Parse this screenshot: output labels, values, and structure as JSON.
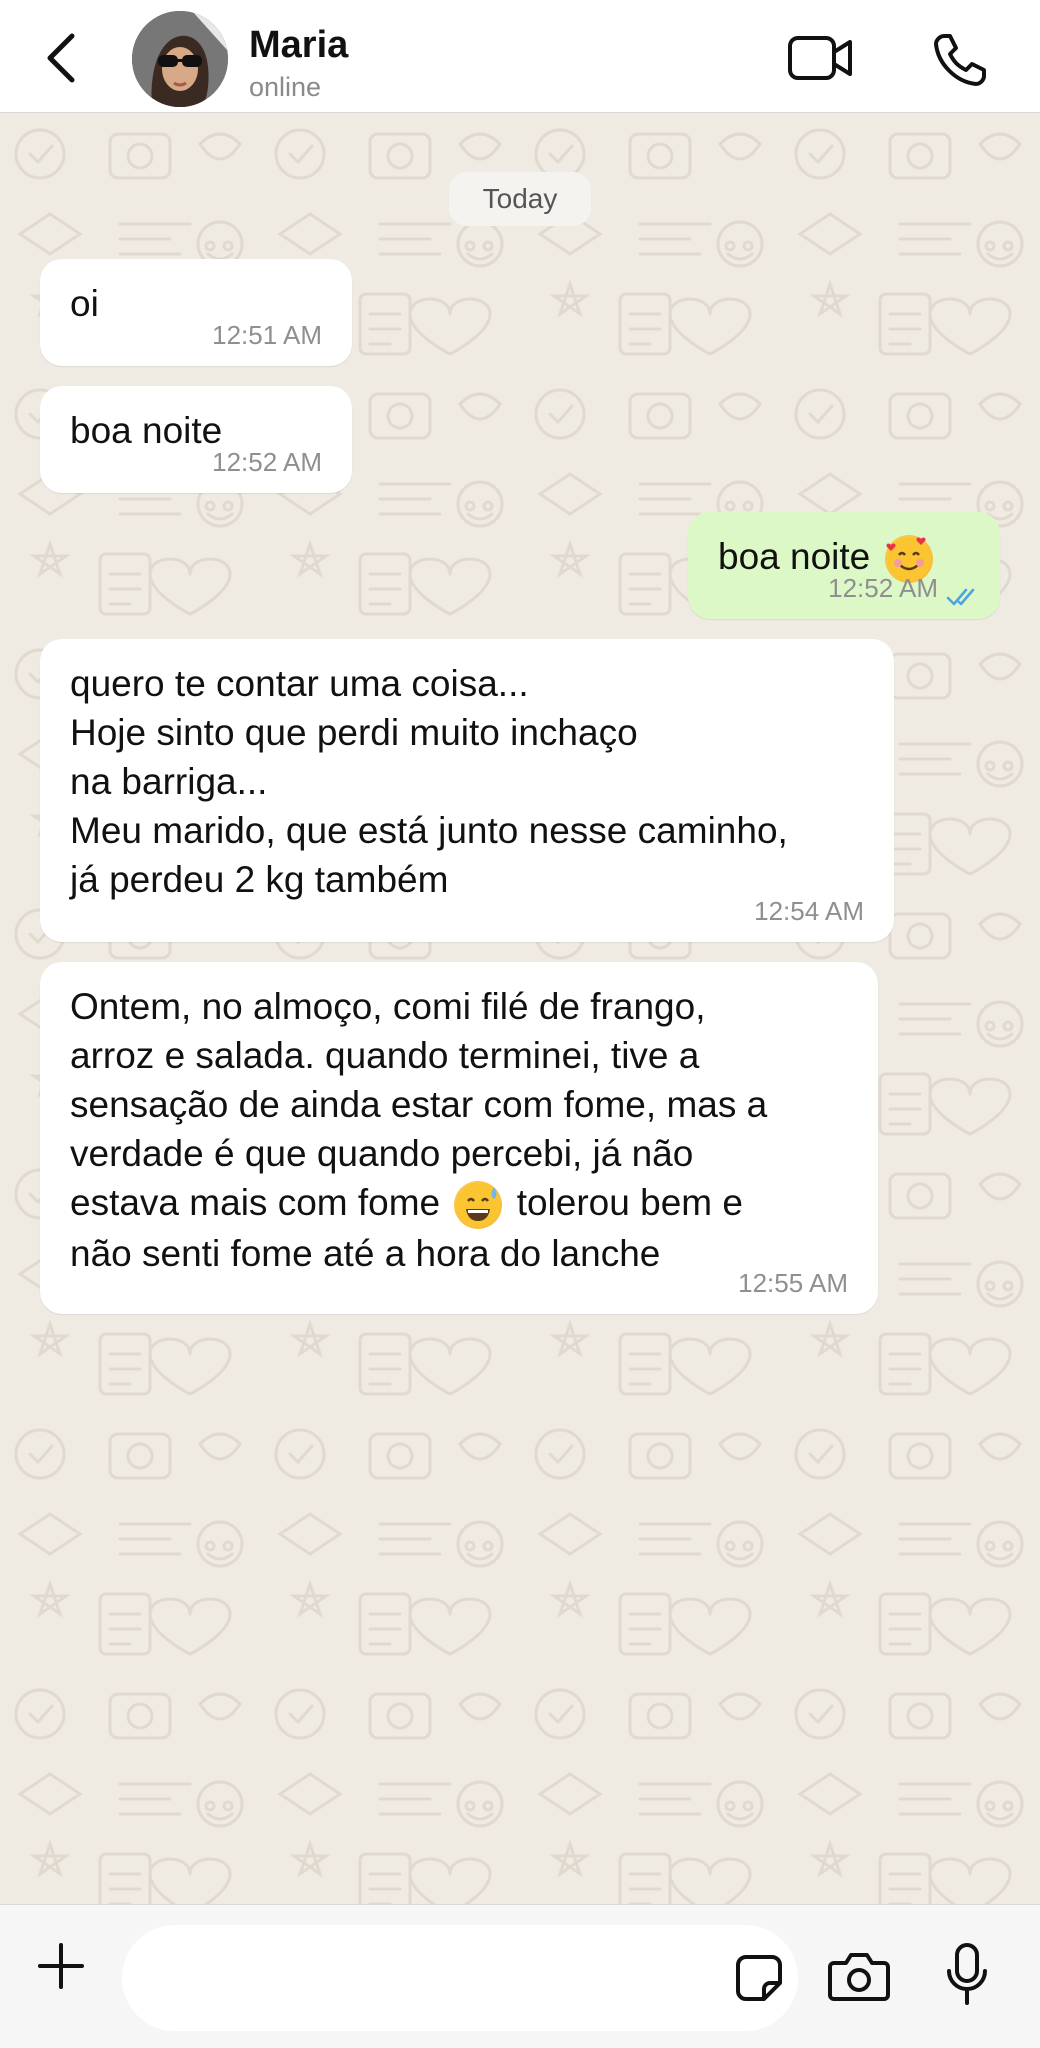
{
  "header": {
    "contact_name": "Maria",
    "contact_status": "online",
    "icons": [
      "back-chevron-icon",
      "avatar",
      "video-call-icon",
      "phone-call-icon"
    ]
  },
  "chat": {
    "date_separator": "Today",
    "messages": [
      {
        "direction": "incoming",
        "text": "oi",
        "time": "12:51 AM"
      },
      {
        "direction": "incoming",
        "text": "boa noite",
        "time": "12:52 AM"
      },
      {
        "direction": "outgoing",
        "text": "boa noite",
        "emoji": "smiling-face-with-hearts",
        "time": "12:52 AM",
        "status": "read"
      },
      {
        "direction": "incoming",
        "text": "quero te contar uma coisa...\nHoje sinto que perdi muito inchaço\nna barriga...\nMeu marido, que está junto nesse caminho,\njá perdeu 2 kg também",
        "time": "12:54 AM"
      },
      {
        "direction": "incoming",
        "text_before_emoji": "Ontem, no almoço, comi filé de frango,\narroz e salada. quando terminei, tive a\nsensação de ainda estar com fome, mas a\nverdade é que quando percebi, já não\nestava mais com fome",
        "emoji": "grinning-face-with-sweat",
        "text_after_emoji": "tolerou bem e\nnão senti fome até a hora do lanche",
        "time": "12:55 AM"
      }
    ]
  },
  "composer": {
    "placeholder": "",
    "icons": [
      "plus-icon",
      "sticker-icon",
      "camera-icon",
      "microphone-icon"
    ]
  },
  "colors": {
    "chat_background": "#efeae2",
    "incoming_bubble": "#ffffff",
    "outgoing_bubble": "#dcf8c6",
    "read_receipt": "#4fa3e3"
  }
}
